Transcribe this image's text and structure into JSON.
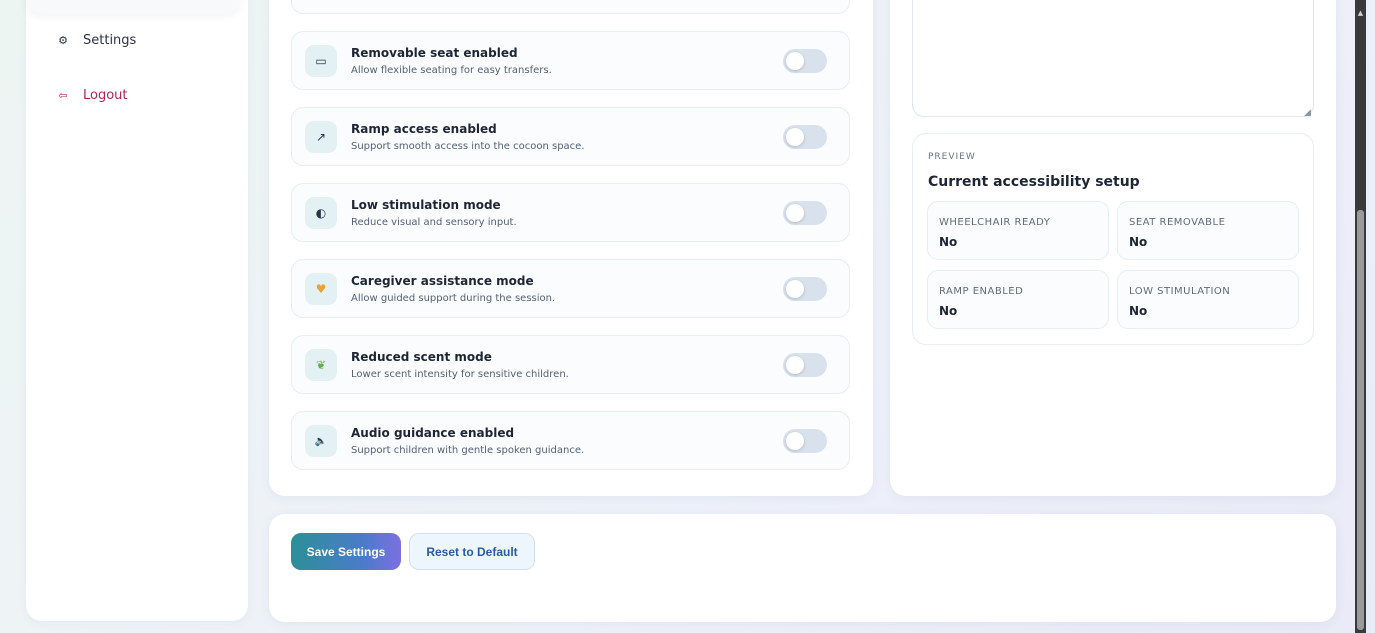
{
  "sidebar": {
    "items": [
      {
        "icon": "gear-icon",
        "glyph": "⚙",
        "label": "Settings"
      },
      {
        "icon": "logout-icon",
        "glyph": "⇦",
        "label": "Logout"
      }
    ]
  },
  "options": [
    {
      "icon": "seat-icon",
      "glyph": "▭",
      "title": "Removable seat enabled",
      "description": "Allow flexible seating for easy transfers.",
      "enabled": false
    },
    {
      "icon": "ramp-icon",
      "glyph": "↗",
      "title": "Ramp access enabled",
      "description": "Support smooth access into the cocoon space.",
      "enabled": false
    },
    {
      "icon": "contrast-icon",
      "glyph": "◐",
      "title": "Low stimulation mode",
      "description": "Reduce visual and sensory input.",
      "enabled": false
    },
    {
      "icon": "heart-hands-icon",
      "glyph": "♥",
      "title": "Caregiver assistance mode",
      "description": "Allow guided support during the session.",
      "enabled": false
    },
    {
      "icon": "leaf-icon",
      "glyph": "❦",
      "title": "Reduced scent mode",
      "description": "Lower scent intensity for sensitive children.",
      "enabled": false
    },
    {
      "icon": "speaker-icon",
      "glyph": "🔈",
      "title": "Audio guidance enabled",
      "description": "Support children with gentle spoken guidance.",
      "enabled": false
    }
  ],
  "notes": {
    "value": "",
    "placeholder": ""
  },
  "preview": {
    "label": "PREVIEW",
    "heading": "Current accessibility setup",
    "stats": [
      {
        "label": "WHEELCHAIR READY",
        "value": "No"
      },
      {
        "label": "SEAT REMOVABLE",
        "value": "No"
      },
      {
        "label": "RAMP ENABLED",
        "value": "No"
      },
      {
        "label": "LOW STIMULATION",
        "value": "No"
      }
    ]
  },
  "actions": {
    "save_label": "Save Settings",
    "reset_label": "Reset to Default"
  },
  "colors": {
    "logout": "#b3264f",
    "accent_start": "#2c8f98",
    "accent_end": "#7c6fe0",
    "reset_text": "#2a5aa8"
  }
}
